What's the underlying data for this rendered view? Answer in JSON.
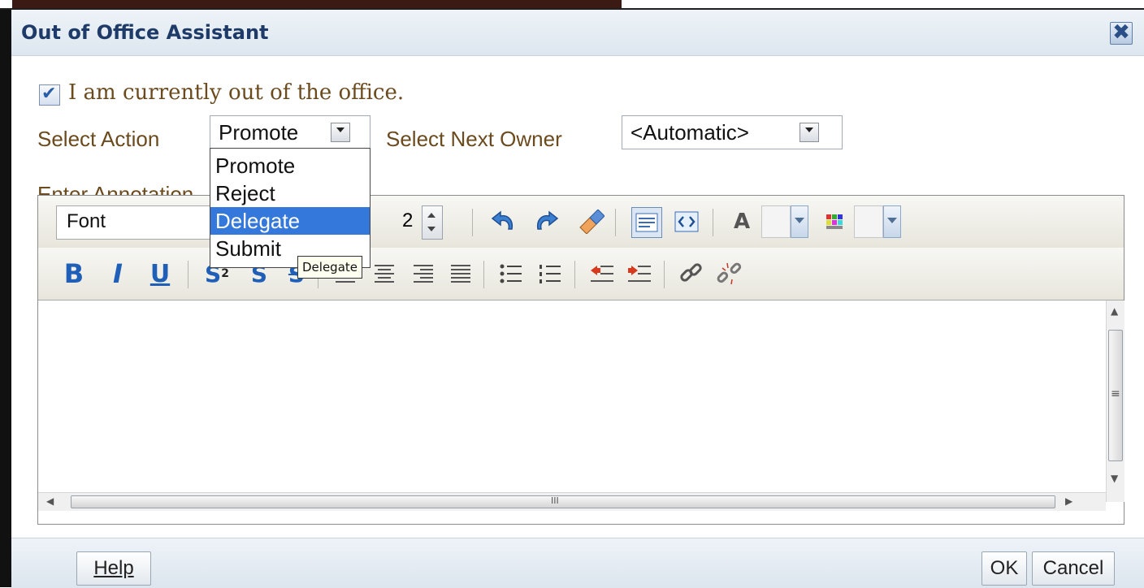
{
  "dialog": {
    "title": "Out of Office Assistant",
    "close_glyph": "✖",
    "out_of_office": {
      "label": "I am currently out of the office.",
      "checked": true,
      "check_glyph": "✔"
    },
    "select_action": {
      "label": "Select Action",
      "value": "Promote",
      "options": [
        "Promote",
        "Reject",
        "Delegate",
        "Submit"
      ],
      "highlighted": "Delegate"
    },
    "select_next_owner": {
      "label": "Select Next Owner",
      "value": "<Automatic>"
    },
    "annotation": {
      "label": "Enter Annotation"
    },
    "editor": {
      "font_value": "Font",
      "size_value": "2",
      "icons_row1": [
        "undo-icon",
        "redo-icon",
        "clear-format-icon",
        "rich-text-mode-icon",
        "source-mode-icon",
        "font-color-icon",
        "highlight-color-icon"
      ],
      "icons_row2": [
        "bold-icon",
        "italic-icon",
        "underline-icon",
        "subscript-icon",
        "superscript-icon",
        "strikethrough-icon",
        "align-left-icon",
        "align-center-icon",
        "align-right-icon",
        "justify-icon",
        "bullet-list-icon",
        "numbered-list-icon",
        "outdent-icon",
        "indent-icon",
        "link-icon",
        "unlink-icon"
      ],
      "glyphs": {
        "bold": "B",
        "italic": "I",
        "underline": "U",
        "subscript": "S",
        "subscript_sub": "2",
        "superscript": "S",
        "strike": "S",
        "font_color": "A"
      },
      "scroll_glyphs": {
        "up": "▲",
        "down": "▼",
        "left": "◀",
        "right": "▶",
        "grip_v": "≡",
        "grip_h": "III"
      }
    },
    "tooltip": "Delegate",
    "buttons": {
      "help": "Help",
      "ok": "OK",
      "cancel": "Cancel"
    },
    "colors": {
      "title": "#1e3a68",
      "label": "#6b4a1e",
      "highlight": "#3478db"
    }
  }
}
